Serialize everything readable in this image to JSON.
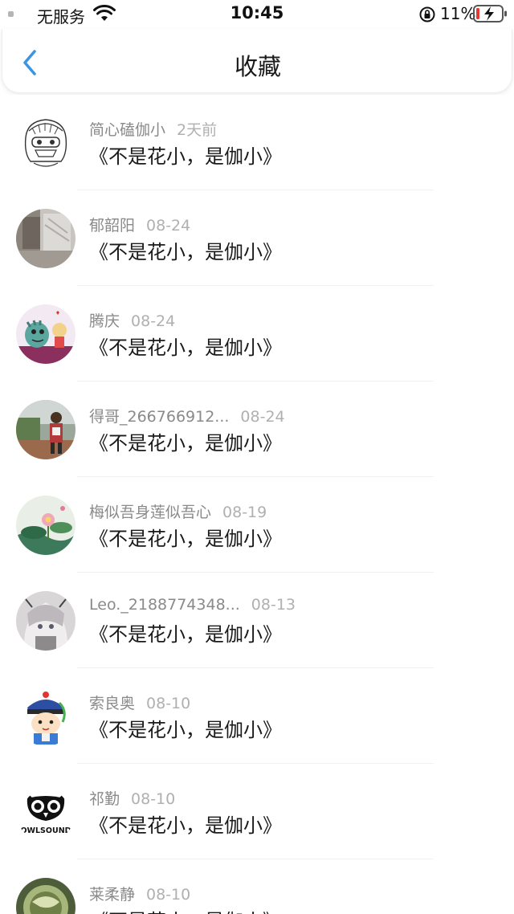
{
  "status_bar": {
    "carrier": "无服务",
    "time": "10:45",
    "battery_pct": "11%"
  },
  "nav": {
    "title": "收藏",
    "back_icon": "chevron-left-icon",
    "accent_color": "#3b95e6"
  },
  "favorites": [
    {
      "name": "简心磕伽小",
      "time": "2天前",
      "content": "《不是花小，是伽小》",
      "avatar": "sketch-girl"
    },
    {
      "name": "郁韶阳",
      "time": "08-24",
      "content": "《不是花小，是伽小》",
      "avatar": "blurry-photo"
    },
    {
      "name": "腾庆",
      "time": "08-24",
      "content": "《不是花小，是伽小》",
      "avatar": "cartoon-dino"
    },
    {
      "name": "得哥_266766912...",
      "time": "08-24",
      "content": "《不是花小，是伽小》",
      "avatar": "person-photo"
    },
    {
      "name": "梅似吾身莲似吾心",
      "time": "08-19",
      "content": "《不是花小，是伽小》",
      "avatar": "lotus-painting"
    },
    {
      "name": "Leo._2188774348...",
      "time": "08-13",
      "content": "《不是花小，是伽小》",
      "avatar": "anime-girl"
    },
    {
      "name": "索良奥",
      "time": "08-10",
      "content": "《不是花小，是伽小》",
      "avatar": "qing-official-cartoon"
    },
    {
      "name": "祁勤",
      "time": "08-10",
      "content": "《不是花小，是伽小》",
      "avatar": "owlsound-logo",
      "avatar_text": "OWLSOUND"
    },
    {
      "name": "莱柔静",
      "time": "08-10",
      "content": "《不是花小，是伽小》",
      "avatar": "green-ink"
    }
  ]
}
